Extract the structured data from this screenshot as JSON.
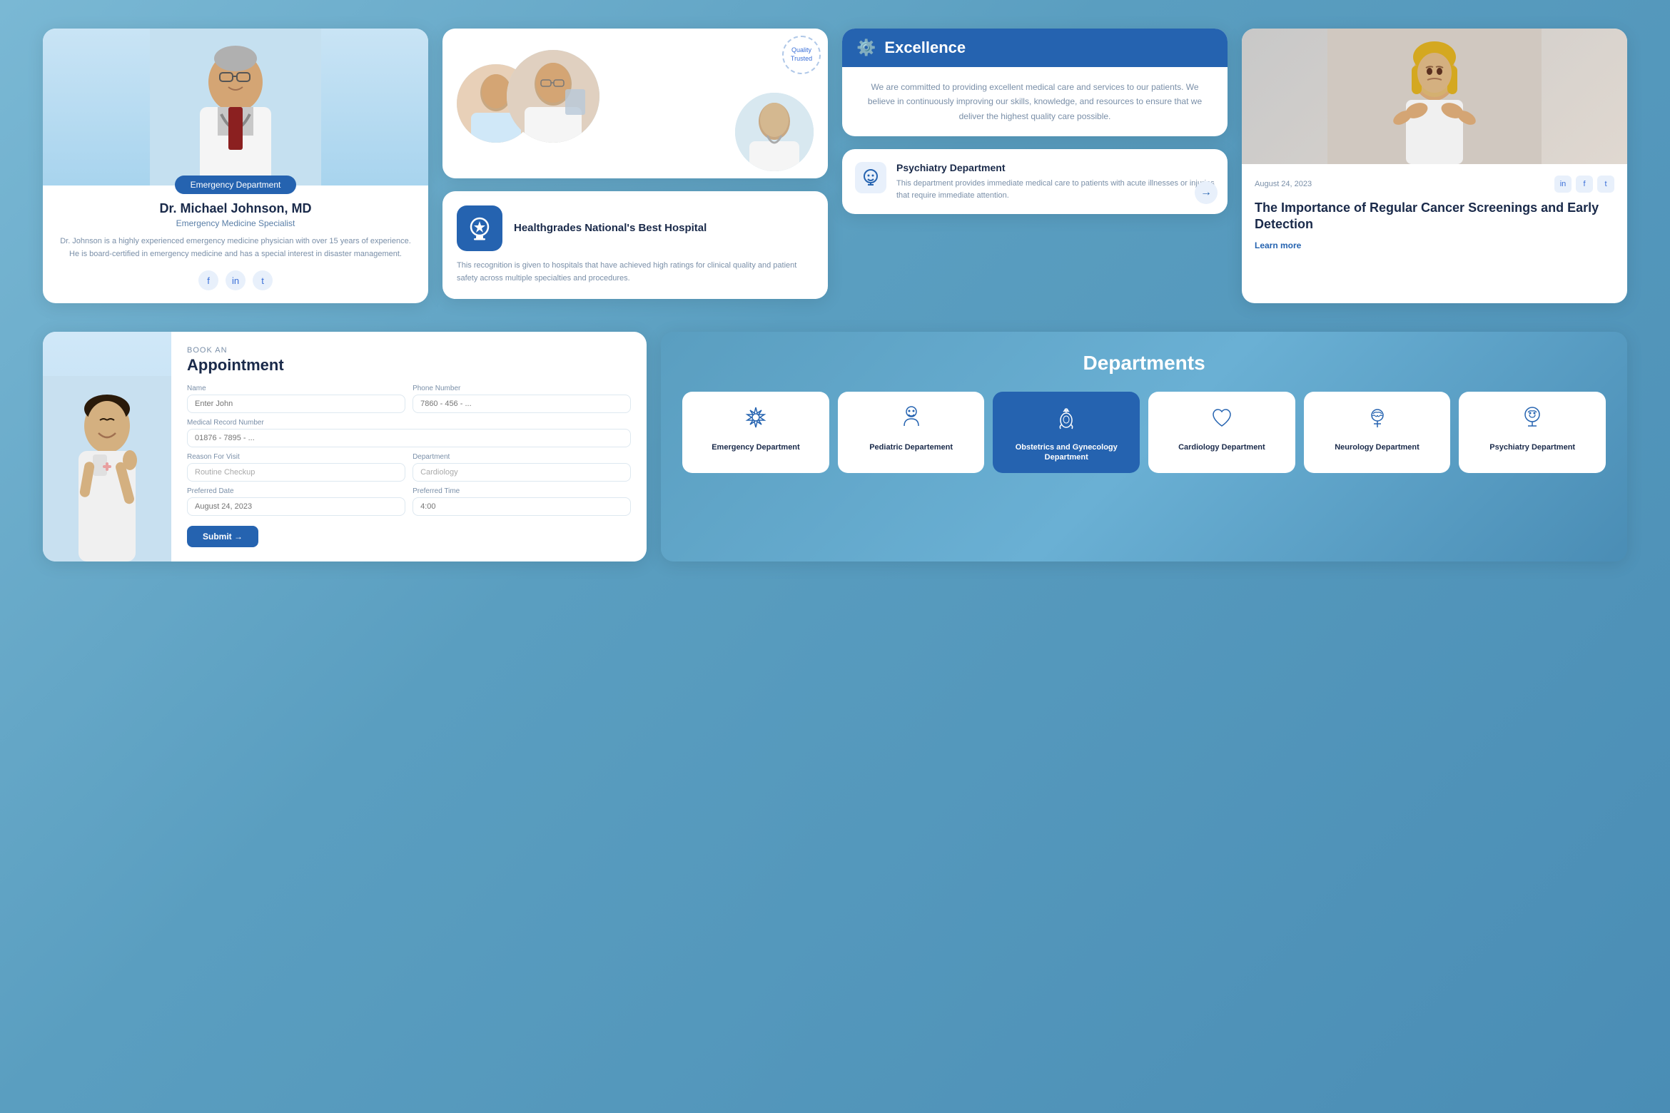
{
  "doctor": {
    "dept_badge": "Emergency Department",
    "name": "Dr. Michael Johnson, MD",
    "specialty": "Emergency Medicine Specialist",
    "bio": "Dr. Johnson is a highly experienced emergency medicine physician with over 15 years of experience. He is board-certified in emergency medicine and has a special interest in disaster management.",
    "social": [
      "f",
      "in",
      "t"
    ]
  },
  "team": {
    "award_badge_line1": "Quality",
    "award_badge_line2": "Trusted"
  },
  "healthgrades": {
    "title": "Healthgrades National's Best Hospital",
    "desc": "This recognition is given to hospitals that have achieved high ratings for clinical quality and patient safety across multiple specialties and procedures."
  },
  "excellence": {
    "header": "Excellence",
    "body": "We are committed to providing excellent medical care and services to our patients. We believe in continuously improving our skills, knowledge, and resources to ensure that we deliver the highest quality care possible."
  },
  "psychiatry_dept": {
    "title": "Psychiatry Department",
    "desc": "This department provides immediate medical care to patients with acute illnesses or injuries that require immediate attention."
  },
  "article": {
    "date": "August 24, 2023",
    "title": "The Importance of Regular Cancer Screenings and Early Detection",
    "learn_more": "Learn more"
  },
  "appointment": {
    "book_an": "BOOK AN",
    "title": "Appointment",
    "name_label": "Name",
    "name_placeholder": "Enter John",
    "phone_label": "Phone Number",
    "phone_placeholder": "7860 - 456 - ...",
    "record_label": "Medical Record Number",
    "record_placeholder": "01876 - 7895 - ...",
    "reason_label": "Reason For Visit",
    "reason_placeholder": "Routine Checkup",
    "dept_label": "Department",
    "dept_placeholder": "Cardiology",
    "date_label": "Preferred Date",
    "date_placeholder": "August 24, 2023",
    "time_label": "Preferred Time",
    "time_placeholder": "4:00",
    "submit_label": "Submit →"
  },
  "departments": {
    "title": "Departments",
    "items": [
      {
        "icon": "🚨",
        "label": "Emergency Department",
        "active": false
      },
      {
        "icon": "👶",
        "label": "Pediatric Departement",
        "active": false
      },
      {
        "icon": "🫀",
        "label": "Obstetrics and Gynecology Department",
        "active": true
      },
      {
        "icon": "❤️",
        "label": "Cardiology Department",
        "active": false
      },
      {
        "icon": "🧠",
        "label": "Neurology Department",
        "active": false
      },
      {
        "icon": "🧬",
        "label": "Psychiatry Department",
        "active": false
      }
    ]
  }
}
